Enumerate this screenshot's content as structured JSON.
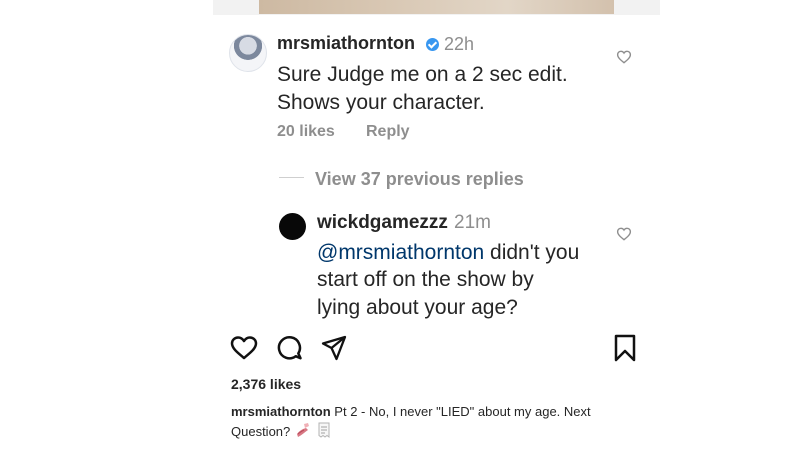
{
  "post": {
    "likes": "2,376 likes",
    "caption": {
      "user": "mrsmiathornton",
      "text": "Pt 2 - No, I never \"LIED\" about my age.  Next Question?"
    }
  },
  "comment": {
    "username": "mrsmiathornton",
    "time": "22h",
    "text_line1": "Sure Judge me on a 2 sec edit.",
    "text_line2": "Shows your character.",
    "likes": "20 likes",
    "reply_label": "Reply",
    "verified": true
  },
  "replies": {
    "view_label": "View 37 previous replies",
    "items": [
      {
        "username": "wickdgamezzz",
        "time": "21m",
        "mention": "@mrsmiathornton",
        "text_line1_rest": " didn't you",
        "text_line2": "start off on the show by",
        "text_line3": "lying about your age?"
      }
    ]
  },
  "icons": {
    "like": "heart-icon",
    "comment": "comment-icon",
    "share": "send-icon",
    "save": "bookmark-icon",
    "small_like": "heart-icon",
    "caption_emojis": [
      "nail-polish-icon",
      "receipt-icon"
    ]
  },
  "colors": {
    "text": "#262626",
    "secondary": "#8e8e8e",
    "mention": "#00376b",
    "verified": "#3897f0"
  }
}
